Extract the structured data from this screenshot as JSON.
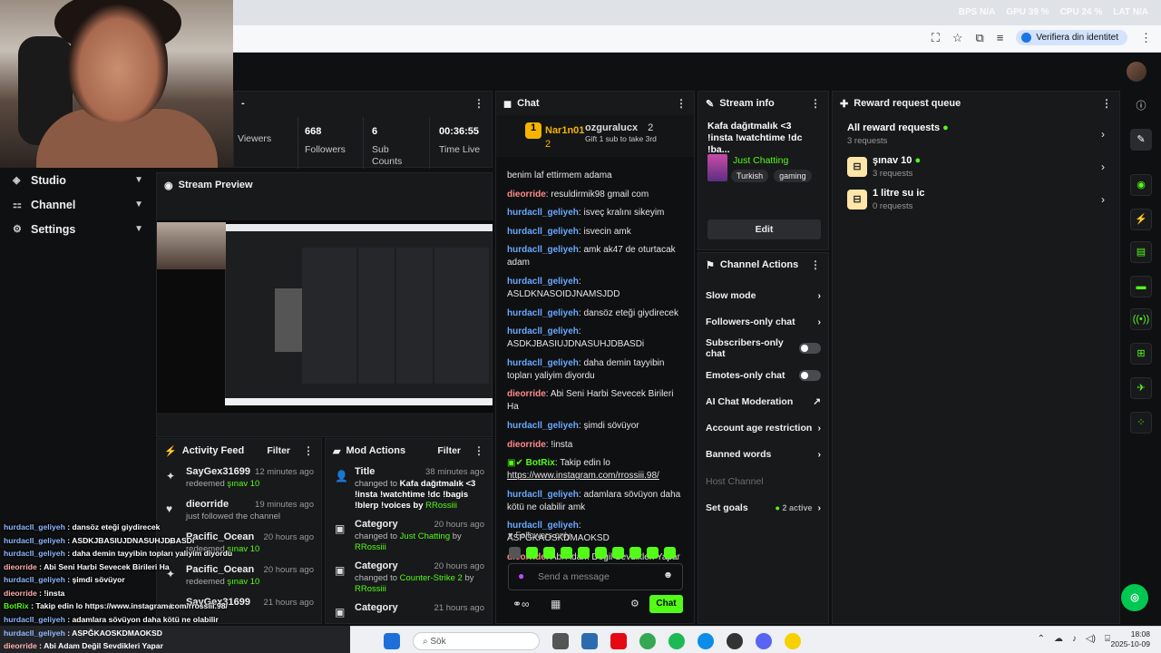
{
  "perf": {
    "fps_label": "BPS",
    "fps_value": "N/A",
    "gpu_label": "GPU",
    "gpu_value": "39 %",
    "cpu_label": "CPU",
    "cpu_value": "24 %",
    "lat_label": "LAT",
    "lat_value": "N/A"
  },
  "browser": {
    "verify_label": "Verifiera din identitet"
  },
  "nav": {
    "items": [
      {
        "label": "Studio"
      },
      {
        "label": "Channel"
      },
      {
        "label": "Settings"
      }
    ]
  },
  "stats": [
    {
      "value": "",
      "label": "Viewers"
    },
    {
      "value": "668",
      "label": "Followers"
    },
    {
      "value": "6",
      "label": "Sub Counts"
    },
    {
      "value": "00:36:55",
      "label": "Time Live"
    }
  ],
  "preview": {
    "title": "Stream Preview"
  },
  "activity": {
    "title": "Activity Feed",
    "filter": "Filter",
    "items": [
      {
        "name": "SayGex31699",
        "time": "12 minutes ago",
        "sub_pre": "redeemed ",
        "sub_hl": "şınav 10"
      },
      {
        "name": "dieorride",
        "time": "19 minutes ago",
        "sub_pre": "just followed the channel",
        "sub_hl": ""
      },
      {
        "name": "Pacific_Ocean",
        "time": "20 hours ago",
        "sub_pre": "redeemed ",
        "sub_hl": "şınav 10"
      },
      {
        "name": "Pacific_Ocean",
        "time": "20 hours ago",
        "sub_pre": "redeemed ",
        "sub_hl": "şınav 10"
      },
      {
        "name": "SayGex31699",
        "time": "21 hours ago",
        "sub_pre": "",
        "sub_hl": ""
      }
    ]
  },
  "mod": {
    "title": "Mod Actions",
    "filter": "Filter",
    "items": [
      {
        "name": "Title",
        "time": "38 minutes ago",
        "line1": "changed to",
        "line1b": " Kafa dağıtmalık <3",
        "line2": " !insta !watchtime !dc !bagis !blerp !voices by ",
        "by": "RRossiii"
      },
      {
        "name": "Category",
        "time": "20 hours ago",
        "line1": "changed to ",
        "line1b": "Just Chatting",
        "line2": " by ",
        "by": "RRossiii"
      },
      {
        "name": "Category",
        "time": "20 hours ago",
        "line1": "changed to ",
        "line1b": "Counter-Strike 2",
        "line2": " by ",
        "by": "RRossiii"
      },
      {
        "name": "Category",
        "time": "21 hours ago",
        "line1": "",
        "line1b": "",
        "line2": "",
        "by": ""
      }
    ]
  },
  "chat": {
    "title": "Chat",
    "top1_name": "Nar1n01",
    "top1_count": "2",
    "top2_name": "ozguralucx",
    "top2_count": "2",
    "gift_text": "Gift 1 sub to take 3rd",
    "messages": [
      {
        "user": "",
        "text": "benim laf ettirmem adama",
        "cls": "u"
      },
      {
        "user": "dieorride",
        "text": "resuldirmik98 gmail com",
        "cls": "u2"
      },
      {
        "user": "hurdacll_geliyeh",
        "text": "isveç kralını sikeyim",
        "cls": "u"
      },
      {
        "user": "hurdacll_geliyeh",
        "text": "isvecin amk",
        "cls": "u"
      },
      {
        "user": "hurdacll_geliyeh",
        "text": "amk ak47 de oturtacak adam",
        "cls": "u"
      },
      {
        "user": "hurdacll_geliyeh",
        "text": "ASLDKNASOIDJNAMSJDD",
        "cls": "u"
      },
      {
        "user": "hurdacll_geliyeh",
        "text": "dansöz eteği giydirecek",
        "cls": "u"
      },
      {
        "user": "hurdacll_geliyeh",
        "text": "ASDKJBASIUJDNASUHJDBASDi",
        "cls": "u"
      },
      {
        "user": "hurdacll_geliyeh",
        "text": "daha demin tayyibin topları yaliyim diyordu",
        "cls": "u"
      },
      {
        "user": "dieorride",
        "text": "Abi Seni Harbi Sevecek Birileri Ha",
        "cls": "u2"
      },
      {
        "user": "hurdacll_geliyeh",
        "text": "şimdi sövüyor",
        "cls": "u"
      },
      {
        "user": "dieorride",
        "text": "!insta",
        "cls": "u2"
      },
      {
        "user": "BotRix",
        "text": "Takip edin lo",
        "link": "https://www.instagram.com/rrossiii.98/",
        "cls": "u3"
      },
      {
        "user": "hurdacll_geliyeh",
        "text": "adamlara sövüyon daha kötü ne olabilir amk",
        "cls": "u"
      },
      {
        "user": "hurdacll_geliyeh",
        "text": "ASPĞKAOSKDMAOKSD",
        "cls": "u"
      },
      {
        "user": "dieorride",
        "text": "Abi Adam Değil Sevdikleri Yapar",
        "cls": "u2"
      }
    ],
    "followers_only": "Followers only",
    "placeholder": "Send a message",
    "send_label": "Chat"
  },
  "stream_info": {
    "title": "Stream info",
    "stream_title": "Kafa dağıtmalık <3 !insta !watchtime !dc !ba...",
    "category": "Just Chatting",
    "tags": [
      "Turkish",
      "gaming"
    ],
    "edit": "Edit"
  },
  "channel_actions": {
    "title": "Channel Actions",
    "items": [
      {
        "label": "Slow mode",
        "ctrl": "chev"
      },
      {
        "label": "Followers-only chat",
        "ctrl": "chev"
      },
      {
        "label": "Subscribers-only chat",
        "ctrl": "toggle"
      },
      {
        "label": "Emotes-only chat",
        "ctrl": "toggle"
      },
      {
        "label": "AI Chat Moderation",
        "ctrl": "ext"
      },
      {
        "label": "Account age restriction",
        "ctrl": "chev"
      },
      {
        "label": "Banned words",
        "ctrl": "chev"
      },
      {
        "label": "Host Channel",
        "ctrl": "none"
      },
      {
        "label": "Set goals",
        "ctrl": "chev",
        "extra": "2 active"
      }
    ]
  },
  "rewards": {
    "title": "Reward request queue",
    "all_label": "All reward requests",
    "all_count": "3 requests",
    "items": [
      {
        "label": "şınav 10",
        "count": "3 requests"
      },
      {
        "label": "1 litre su ic",
        "count": "0 requests"
      }
    ]
  },
  "overlay_lines": [
    {
      "u": "hurdacll_geliyeh",
      "t": " : dansöz eteği giydirecek",
      "c": "u"
    },
    {
      "u": "hurdacll_geliyeh",
      "t": " : ASDKJBASIUJDNASUHJDBASDi",
      "c": "u"
    },
    {
      "u": "hurdacll_geliyeh",
      "t": " : daha demin tayyibin topları yaliyim diyordu",
      "c": "u"
    },
    {
      "u": "dieorride",
      "t": " : Abi Seni Harbi Sevecek Birileri Ha",
      "c": "u2"
    },
    {
      "u": "hurdacll_geliyeh",
      "t": " : şimdi sövüyor",
      "c": "u"
    },
    {
      "u": "dieorride",
      "t": " : !insta",
      "c": "u2"
    },
    {
      "u": "BotRix",
      "t": " : Takip edin lo https://www.instagram.com/rrossiii.98/",
      "c": "u"
    },
    {
      "u": "hurdacll_geliyeh",
      "t": " : adamlara sövüyon daha kötü ne olabilir amk",
      "c": "u"
    },
    {
      "u": "hurdacll_geliyeh",
      "t": " : ASPĞKAOSKDMAOKSD",
      "c": "u"
    },
    {
      "u": "dieorride",
      "t": " : Abi Adam Değil Sevdikleri Yapar",
      "c": "u2"
    }
  ],
  "taskbar": {
    "search": "Sök",
    "time": "18:08",
    "date": "2025-10-09"
  },
  "colors": {
    "accent": "#53fc18",
    "bg": "#0f1011",
    "panel": "#18191b"
  }
}
